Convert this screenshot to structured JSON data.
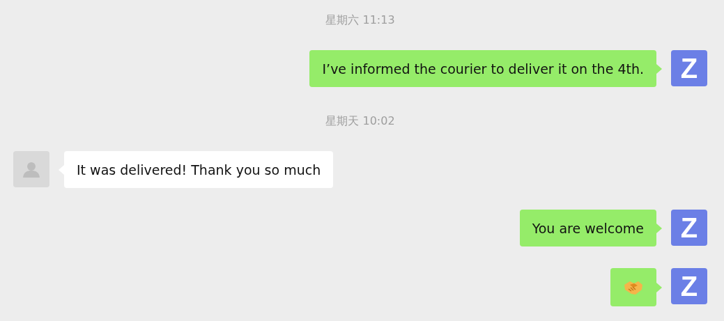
{
  "messages": [
    {
      "kind": "time",
      "text": "星期六 11:13"
    },
    {
      "kind": "text",
      "sent": true,
      "avatar": "Z",
      "text": "I’ve informed the courier to deliver it on the 4th."
    },
    {
      "kind": "time",
      "text": "星期天 10:02"
    },
    {
      "kind": "text",
      "sent": false,
      "text": "It was delivered! Thank you so much"
    },
    {
      "kind": "text",
      "sent": true,
      "avatar": "Z",
      "text": "You are welcome"
    },
    {
      "kind": "emoji",
      "sent": true,
      "avatar": "Z"
    }
  ]
}
